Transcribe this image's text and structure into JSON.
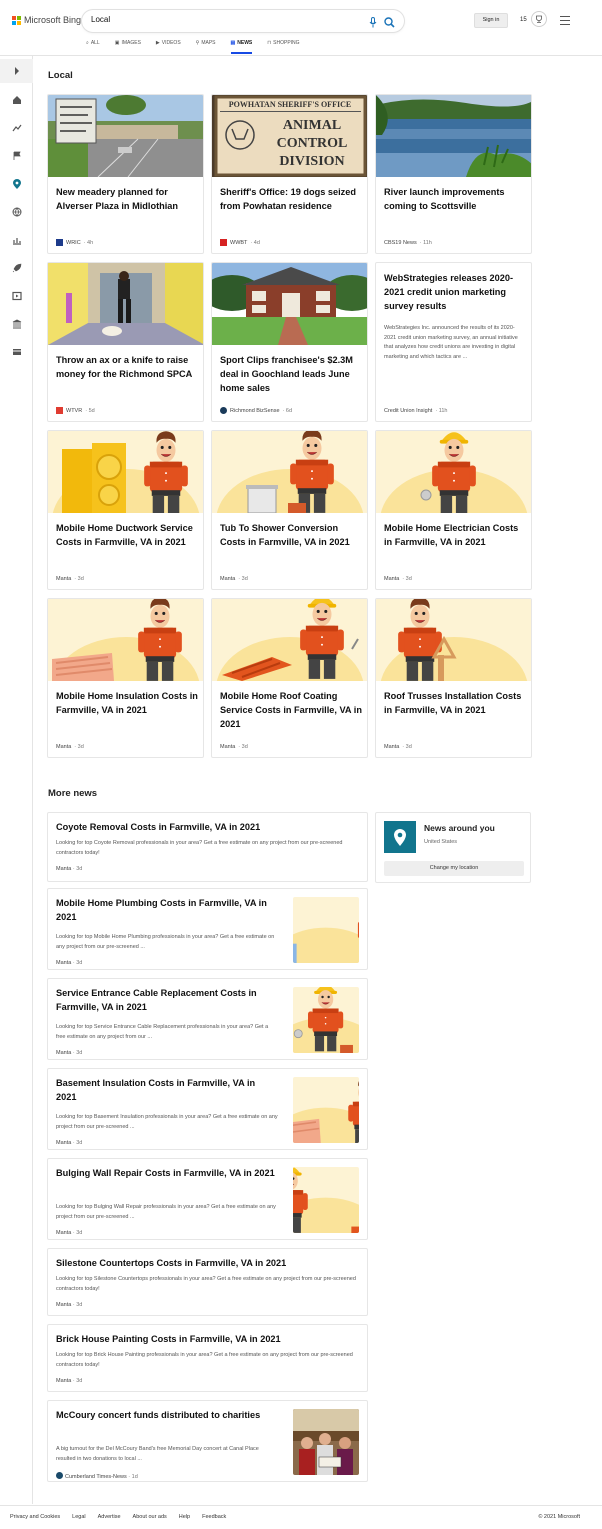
{
  "header": {
    "brand": "Microsoft Bing",
    "query": "Local",
    "sign_in": "Sign in",
    "points": "15",
    "tabs": [
      {
        "label": "ALL",
        "icon": "search-icon"
      },
      {
        "label": "IMAGES",
        "icon": "image-icon"
      },
      {
        "label": "VIDEOS",
        "icon": "video-icon"
      },
      {
        "label": "MAPS",
        "icon": "map-pin-icon"
      },
      {
        "label": "NEWS",
        "icon": "news-icon",
        "active": true
      },
      {
        "label": "SHOPPING",
        "icon": "shopping-bag-icon"
      }
    ]
  },
  "sidebar": {
    "items": [
      "expand-icon",
      "home-icon",
      "trending-icon",
      "flag-icon",
      "location-icon",
      "globe-icon",
      "money-icon",
      "rocket-icon",
      "entertainment-icon",
      "politics-icon",
      "card-icon"
    ]
  },
  "local": {
    "title": "Local",
    "cards": [
      {
        "title": "New meadery planned for Alverser Plaza in Midlothian",
        "source": "WRIC",
        "age": "4h",
        "fav_color": "#1d3b8b",
        "img": "plaza"
      },
      {
        "title": "Sheriff's Office: 19 dogs seized from Powhatan residence",
        "source": "WWBT",
        "age": "4d",
        "fav_color": "#d62222",
        "img": "sign",
        "sign_lines": [
          "POWHATAN SHERIFF'S OFFICE",
          "ANIMAL",
          "CONTROL",
          "DIVISION"
        ]
      },
      {
        "title": "River launch improvements coming to Scottsville",
        "source": "CBS19 News",
        "age": "11h",
        "fav_color": null,
        "img": "river"
      },
      {
        "title": "Throw an ax or a knife to raise money for the Richmond SPCA",
        "source": "WTVR",
        "age": "5d",
        "fav_color": "#e03c31",
        "img": "hallway"
      },
      {
        "title": "Sport Clips franchisee's $2.3M deal in Goochland leads June home sales",
        "source": "Richmond BizSense",
        "age": "6d",
        "fav_color": "#1a3a5a",
        "img": "house"
      },
      {
        "title": "WebStrategies releases 2020-2021 credit union marketing survey results",
        "description": "WebStrategies Inc. announced the results of its 2020-2021 credit union marketing survey, an annual initiative that analyzes how credit unions are investing in digital marketing and which tactics are ...",
        "source": "Credit Union Insight",
        "age": "11h",
        "fav_color": null,
        "img": null
      },
      {
        "title": "Mobile Home Ductwork Service Costs in Farmville, VA in 2021",
        "source": "Manta",
        "age": "3d",
        "img": "duct"
      },
      {
        "title": "Tub To Shower Conversion Costs in Farmville, VA in 2021",
        "source": "Manta",
        "age": "3d",
        "img": "tub"
      },
      {
        "title": "Mobile Home Electrician Costs in Farmville, VA in 2021",
        "source": "Manta",
        "age": "3d",
        "img": "electric"
      },
      {
        "title": "Mobile Home Insulation Costs in Farmville, VA in 2021",
        "source": "Manta",
        "age": "3d",
        "img": "insulation"
      },
      {
        "title": "Mobile Home Roof Coating Service Costs in Farmville, VA in 2021",
        "source": "Manta",
        "age": "3d",
        "img": "roof"
      },
      {
        "title": "Roof Trusses Installation Costs in Farmville, VA in 2021",
        "source": "Manta",
        "age": "3d",
        "img": "truss"
      }
    ]
  },
  "more_news": {
    "title": "More news",
    "items": [
      {
        "title": "Coyote Removal Costs in Farmville, VA in 2021",
        "description": "Looking for top Coyote Removal professionals in your area? Get a free estimate on any project from our pre-screened contractors today!",
        "source": "Manta",
        "age": "3d",
        "thumb": null
      },
      {
        "title": "Mobile Home Plumbing Costs in Farmville, VA in 2021",
        "description": "Looking for top Mobile Home Plumbing professionals in your area? Get a free estimate on any project from our pre-screened ...",
        "source": "Manta",
        "age": "3d",
        "thumb": "plumb"
      },
      {
        "title": "Service Entrance Cable Replacement Costs in Farmville, VA in 2021",
        "description": "Looking for top Service Entrance Cable Replacement professionals in your area? Get a free estimate on any project from our ...",
        "source": "Manta",
        "age": "3d",
        "thumb": "cable"
      },
      {
        "title": "Basement Insulation Costs in Farmville, VA in 2021",
        "description": "Looking for top Basement Insulation professionals in your area? Get a free estimate on any project from our pre-screened ...",
        "source": "Manta",
        "age": "3d",
        "thumb": "basement"
      },
      {
        "title": "Bulging Wall Repair Costs in Farmville, VA in 2021",
        "description": "Looking for top Bulging Wall Repair professionals in your area? Get a free estimate on any project from our pre-screened ...",
        "source": "Manta",
        "age": "3d",
        "thumb": "wall"
      },
      {
        "title": "Silestone Countertops Costs in Farmville, VA in 2021",
        "description": "Looking for top Silestone Countertops professionals in your area? Get a free estimate on any project from our pre-screened contractors today!",
        "source": "Manta",
        "age": "3d",
        "thumb": null
      },
      {
        "title": "Brick House Painting Costs in Farmville, VA in 2021",
        "description": "Looking for top Brick House Painting professionals in your area? Get a free estimate on any project from our pre-screened contractors today!",
        "source": "Manta",
        "age": "3d",
        "thumb": null
      },
      {
        "title": "McCoury concert funds distributed to charities",
        "description": "A big turnout for the Del McCoury Band's free Memorial Day concert at Canal Place resulted in two donations to local ...",
        "source": "Cumberland Times-News",
        "age": "1d",
        "thumb": "concert"
      }
    ]
  },
  "news_around": {
    "title": "News around you",
    "location": "United States",
    "button": "Change my location",
    "pin_color": "#12758d"
  },
  "footer": {
    "links": [
      "Privacy and Cookies",
      "Legal",
      "Advertise",
      "About our ads",
      "Help",
      "Feedback"
    ],
    "copyright": "© 2021 Microsoft"
  },
  "colors": {
    "accent": "#174ae4",
    "manta_bg": "#fdf3d4",
    "manta_sun": "#fae8a4"
  }
}
